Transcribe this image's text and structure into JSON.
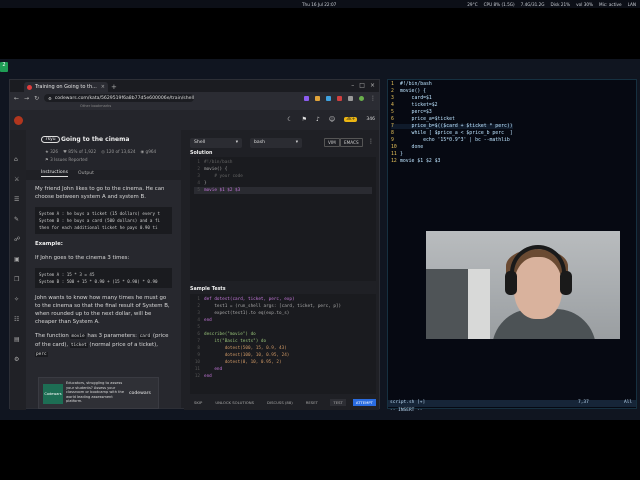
{
  "topbar": {
    "clock": "Thu 16 Jul 22:07",
    "stats": [
      "29°C",
      "CPU 8% (1.5G)",
      "7.4G/31.2G",
      "Disk 21%",
      "vol 30%",
      "Mic: active",
      "LAN"
    ]
  },
  "dock": {
    "label": "2"
  },
  "browser": {
    "tab_title": "Training on Going to th...",
    "new_tab": "+",
    "url": "codewars.com/kata/5629519f6a8b77d5e600006e/train/shell",
    "bookmarks_text": "Other bookmarks"
  },
  "codewars": {
    "honor": "3k+",
    "rank_count": "346",
    "kata": {
      "kyu": "7kyu",
      "title": "Going to the cinema",
      "stats": [
        "326",
        "85% of 1,922",
        "120 of 13,624",
        "g964"
      ],
      "flag": "3 Issues Reported"
    },
    "subtabs": [
      "Instructions",
      "Output"
    ],
    "description": {
      "p1": "My friend John likes to go to the cinema. He can choose between system A and system B.",
      "code1": "System A : he buys a ticket (15 dollars) every t\nSystem B : he buys a card (500 dollars) and a fi\nthen for each additional ticket he pays 0.90 ti",
      "example_heading": "Example:",
      "p2": "If John goes to the cinema 3 times:",
      "code2": "System A : 15 * 3 = 45\nSystem B : 500 + 15 * 0.90 + (15 * 0.90) * 0.90",
      "p3": "John wants to know how many times he must go to the cinema so that the final result of System B, when rounded up to the next dollar, will be cheaper than System A.",
      "p4_pre": "The function",
      "p4_fn": "movie",
      "p4_mid": "has 3 parameters:",
      "p4_card": "card",
      "p4_post": "(price of the card),",
      "p4_ticket": "ticket",
      "p4_post2": "(normal price of a ticket),",
      "p4_perc": "perc"
    },
    "ad": {
      "logo": "Codewars",
      "text": "Educators, struggling to assess your students? Assess your classroom or bootcamp with the world leading assessment platform.",
      "brand": "codewars"
    },
    "language": "Shell",
    "version": "bash",
    "modes": [
      "VIM",
      "EMACS"
    ],
    "solution_title": "Solution",
    "solution_lines": [
      "#!/bin/bash",
      "movie() {",
      "    # your code",
      "}",
      "movie $1 $2 $3"
    ],
    "tests_title": "Sample Tests",
    "test_lines": [
      "def dotest(card, ticket, perc, exp)",
      "    test1 = (run_shell args: [card, ticket, perc, p])",
      "    expect(test1).to eq(exp.to_s)",
      "end",
      "",
      "describe(\"movie\") do",
      "    it(\"Basic tests\") do",
      "        dotest(500, 15, 0.9, 43)",
      "        dotest(100, 10, 0.95, 24)",
      "        dotest(0, 10, 0.95, 2)",
      "    end",
      "end"
    ],
    "bottom_buttons": [
      "SKIP",
      "UNLOCK SOLUTIONS",
      "DISCUSS (88)",
      "RESET",
      "TEST",
      "ATTEMPT"
    ]
  },
  "terminal": {
    "lines": [
      {
        "n": "1",
        "t": "#!/bin/bash"
      },
      {
        "n": "2",
        "t": "movie() {"
      },
      {
        "n": "3",
        "t": "    card=$1"
      },
      {
        "n": "4",
        "t": "    ticket=$2"
      },
      {
        "n": "5",
        "t": "    perc=$3"
      },
      {
        "n": "6",
        "t": "    price_a=$ticket"
      },
      {
        "n": "7",
        "t": "    price_b=$(($card + $ticket * perc))"
      },
      {
        "n": "8",
        "t": "    while [ $price_a < $price_b perc  ]"
      },
      {
        "n": "9",
        "t": "        echo '15*0.9^3' | bc --mathlib"
      },
      {
        "n": "10",
        "t": "    done"
      },
      {
        "n": "11",
        "t": "}"
      },
      {
        "n": "12",
        "t": "movie $1 $2 $3"
      }
    ],
    "status_file": "script.sh [+]",
    "status_pos": "7,37",
    "status_all": "All",
    "mode": "-- INSERT --"
  }
}
